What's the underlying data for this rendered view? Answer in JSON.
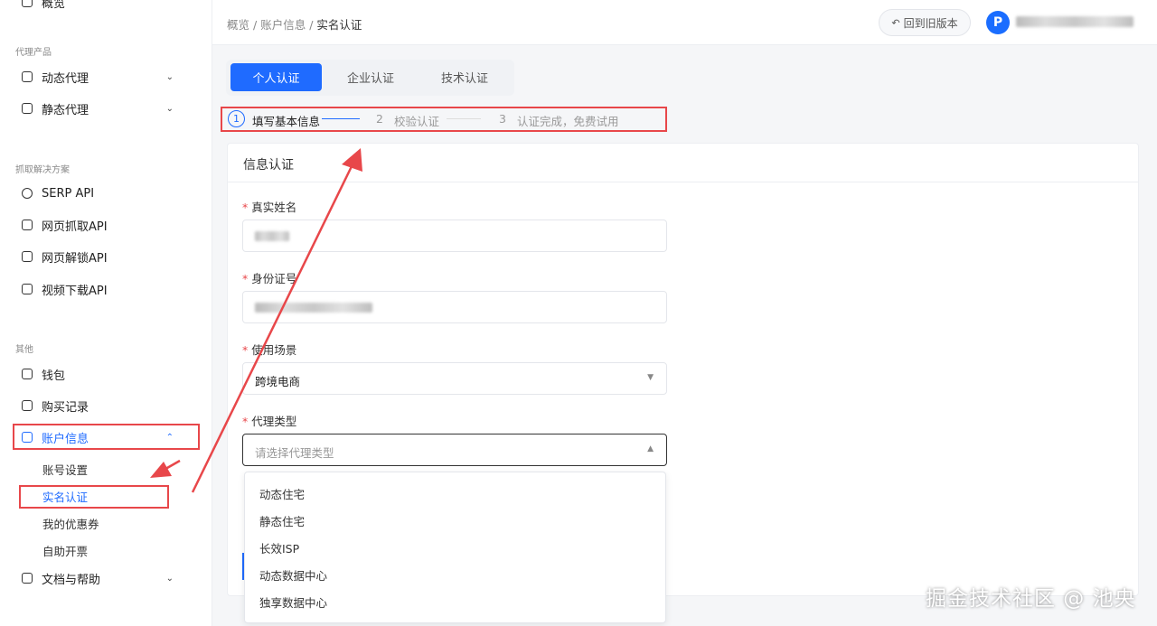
{
  "sidebar": {
    "top_item": "概览",
    "groups": {
      "proxy": "代理产品",
      "scrape": "抓取解决方案",
      "other": "其他"
    },
    "items": {
      "dynamic": "动态代理",
      "static": "静态代理",
      "serp": "SERP API",
      "web_scrape": "网页抓取API",
      "web_unlock": "网页解锁API",
      "video": "视频下载API",
      "wallet": "钱包",
      "orders": "购买记录",
      "account": "账户信息",
      "docs": "文档与帮助"
    },
    "sub": {
      "settings": "账号设置",
      "realname": "实名认证",
      "coupons": "我的优惠券",
      "invoice": "自助开票"
    }
  },
  "header": {
    "crumb1": "概览",
    "crumb2": "账户信息",
    "crumb3": "实名认证",
    "sep": "/",
    "old_version": "回到旧版本",
    "avatar_letter": "P"
  },
  "tabs": [
    "个人认证",
    "企业认证",
    "技术认证"
  ],
  "steps": {
    "s1_num": "1",
    "s1": "填写基本信息",
    "s2_num": "2",
    "s2": "校验认证",
    "s3_num": "3",
    "s3": "认证完成，免费试用"
  },
  "form": {
    "title": "信息认证",
    "name_label": "真实姓名",
    "id_label": "身份证号",
    "scene_label": "使用场景",
    "scene_value": "跨境电商",
    "type_label": "代理类型",
    "type_placeholder": "请选择代理类型",
    "req": "*"
  },
  "dropdown_options": [
    "动态住宅",
    "静态住宅",
    "长效ISP",
    "动态数据中心",
    "独享数据中心"
  ],
  "watermark": "掘金技术社区 @ 池央",
  "colors": {
    "accent": "#1f6bff",
    "annotation": "#e8474a"
  }
}
